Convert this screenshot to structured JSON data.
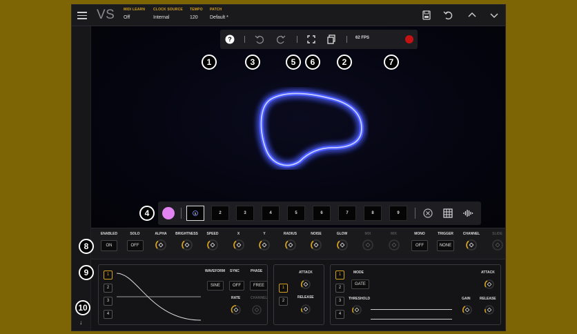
{
  "app": {
    "logo": "VS"
  },
  "header": {
    "fields": [
      {
        "label": "MIDI LEARN",
        "value": "Off"
      },
      {
        "label": "CLOCK SOURCE",
        "value": "Internal"
      },
      {
        "label": "TEMPO",
        "value": "120"
      },
      {
        "label": "PATCH",
        "value": "Default *"
      }
    ],
    "icons": [
      "save-icon",
      "revert-icon",
      "chevron-up-icon",
      "chevron-down-icon"
    ]
  },
  "toolbar": {
    "help_label": "?",
    "fps": "62 FPS",
    "icons": [
      "help-icon",
      "undo-icon",
      "redo-icon",
      "fullscreen-icon",
      "copy-icon",
      "record-icon"
    ]
  },
  "callouts": [
    "1",
    "2",
    "3",
    "4",
    "5",
    "6",
    "7",
    "8",
    "9",
    "10"
  ],
  "colors": {
    "accent": "#d4a21f",
    "shape_glow": "#4a5cff",
    "swatch": "#e184f2",
    "record": "#c41212"
  },
  "slots": [
    "1",
    "2",
    "3",
    "4",
    "5",
    "6",
    "7",
    "8",
    "9"
  ],
  "params": [
    {
      "label": "ENABLED",
      "type": "button",
      "value": "ON"
    },
    {
      "label": "SOLO",
      "type": "button",
      "value": "OFF"
    },
    {
      "label": "ALPHA",
      "type": "knob"
    },
    {
      "label": "BRIGHTNESS",
      "type": "knob"
    },
    {
      "label": "SPEED",
      "type": "knob"
    },
    {
      "label": "X",
      "type": "knob"
    },
    {
      "label": "Y",
      "type": "knob"
    },
    {
      "label": "RADIUS",
      "type": "knob"
    },
    {
      "label": "NOISE",
      "type": "knob"
    },
    {
      "label": "GLOW",
      "type": "knob"
    },
    {
      "label": "MIX",
      "type": "knob",
      "dim": true
    },
    {
      "label": "MIX",
      "type": "knob",
      "dim": true
    },
    {
      "label": "MONO",
      "type": "button",
      "value": "OFF"
    },
    {
      "label": "TRIGGER",
      "type": "button",
      "value": "NONE"
    },
    {
      "label": "CHANNEL",
      "type": "knob"
    },
    {
      "label": "SLIDE",
      "type": "knob",
      "dim": true
    }
  ],
  "lfo": {
    "chips": [
      "1",
      "2",
      "3",
      "4"
    ],
    "waveform_label": "WAVEFORM",
    "waveform_value": "SINE",
    "sync_label": "SYNC",
    "sync_value": "OFF",
    "phase_label": "PHASE",
    "phase_value": "FREE",
    "rate_label": "RATE",
    "channel_label": "CHANNEL"
  },
  "envelope": {
    "chips": [
      "1",
      "2"
    ],
    "attack_label": "ATTACK",
    "release_label": "RELEASE"
  },
  "follower": {
    "chips": [
      "1",
      "2",
      "3",
      "4"
    ],
    "mode_label": "MODE",
    "mode_value": "GATE",
    "threshold_label": "THRESHOLD",
    "gain_label": "GAIN",
    "attack_label": "ATTACK",
    "release_label": "RELEASE"
  }
}
